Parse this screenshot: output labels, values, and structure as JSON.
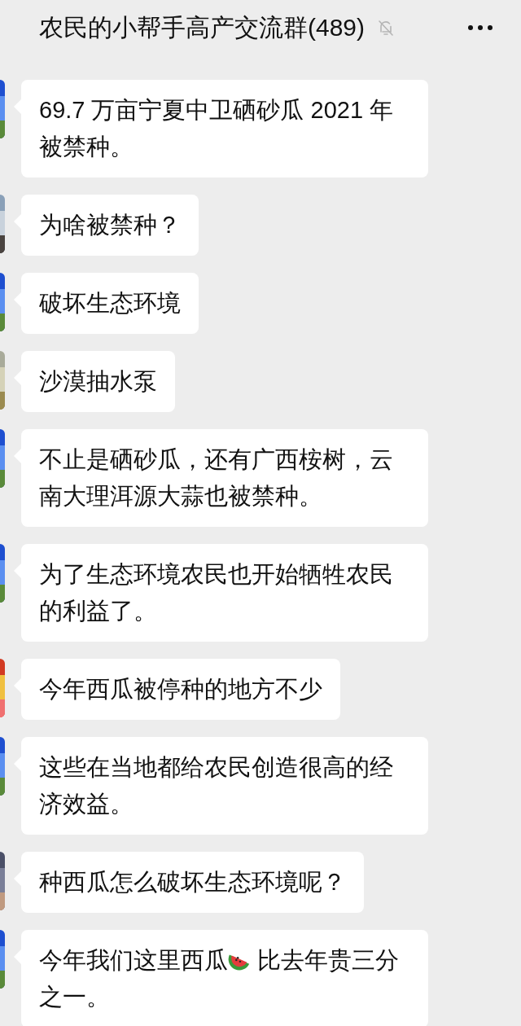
{
  "header": {
    "title": "农民的小帮手高产交流群(489)",
    "muted": true
  },
  "messages": [
    {
      "parts": [
        {
          "kind": "text",
          "text": "69.7 万亩宁夏中卫硒砂瓜 2021 年被禁种。"
        }
      ]
    },
    {
      "parts": [
        {
          "kind": "text",
          "text": "为啥被禁种？"
        }
      ]
    },
    {
      "parts": [
        {
          "kind": "text",
          "text": "破坏生态环境"
        }
      ]
    },
    {
      "parts": [
        {
          "kind": "text",
          "text": "沙漠抽水泵"
        }
      ]
    },
    {
      "parts": [
        {
          "kind": "text",
          "text": "不止是硒砂瓜，还有广西桉树，云南大理洱源大蒜也被禁种。"
        }
      ]
    },
    {
      "parts": [
        {
          "kind": "text",
          "text": "为了生态环境农民也开始牺牲农民的利益了。"
        }
      ]
    },
    {
      "parts": [
        {
          "kind": "text",
          "text": "今年西瓜被停种的地方不少"
        }
      ]
    },
    {
      "parts": [
        {
          "kind": "text",
          "text": "这些在当地都给农民创造很高的经济效益。"
        }
      ]
    },
    {
      "parts": [
        {
          "kind": "text",
          "text": "种西瓜怎么破坏生态环境呢？"
        }
      ]
    },
    {
      "parts": [
        {
          "kind": "text",
          "text": "今年我们这里西瓜"
        },
        {
          "kind": "emoji"
        },
        {
          "kind": "text",
          "text": " 比去年贵三分之一。"
        }
      ]
    }
  ]
}
